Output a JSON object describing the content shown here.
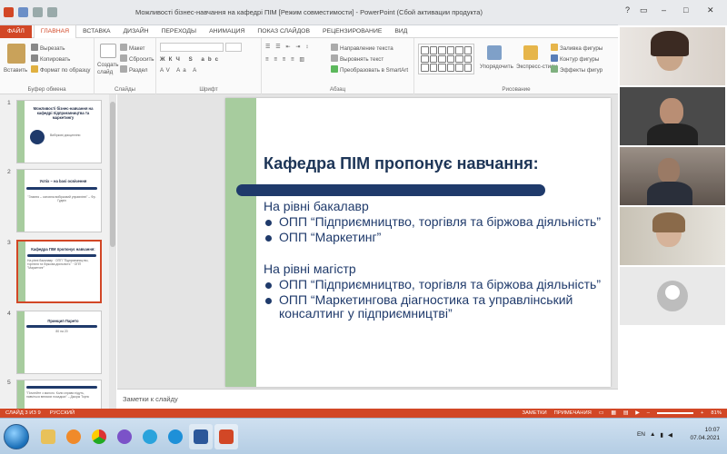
{
  "window": {
    "title": "Можливості бізнес-навчання на кафедрі ПІМ [Режим совместимости] - PowerPoint (Сбой активации продукта)",
    "controls": [
      "?",
      "–",
      "□",
      "✕"
    ]
  },
  "ribbon_tabs": [
    "ФАЙЛ",
    "ГЛАВНАЯ",
    "ВСТАВКА",
    "ДИЗАЙН",
    "ПЕРЕХОДЫ",
    "АНИМАЦИЯ",
    "ПОКАЗ СЛАЙДОВ",
    "РЕЦЕНЗИРОВАНИЕ",
    "ВИД"
  ],
  "ribbon": {
    "clipboard": {
      "paste": "Вставить",
      "cut": "Вырезать",
      "copy": "Копировать",
      "format": "Формат по образцу",
      "label": "Буфер обмена"
    },
    "slides": {
      "new_slide": "Создать слайд",
      "layout": "Макет",
      "reset": "Сбросить",
      "section": "Раздел",
      "label": "Слайды"
    },
    "font": {
      "label": "Шрифт"
    },
    "paragraph": {
      "text_dir": "Направление текста",
      "align": "Выровнять текст",
      "smartart": "Преобразовать в SmartArt",
      "label": "Абзац"
    },
    "drawing": {
      "arrange": "Упорядочить",
      "styles": "Экспресс-стили",
      "fill": "Заливка фигуры",
      "outline": "Контур фигуры",
      "effects": "Эффекты фигур",
      "label": "Рисование"
    }
  },
  "thumbnails": [
    {
      "num": "1",
      "title": "Можливості бізнес-навчання на кафедрі підприємництва та маркетингу",
      "sub": "Вибіркові дисципліни"
    },
    {
      "num": "2",
      "title": "Успіх – на basi освічення",
      "sub": "\"Знання – основна вибірковий управлінні\" – Фр. Гудвін"
    },
    {
      "num": "3",
      "title": "Кафедра ПІМ пропонує навчання:",
      "sub": "На рівні бакалавр · ОПП \"Підприємництво, торгівля та біржова діяльність\" · ОПП \"Маркетинг\""
    },
    {
      "num": "4",
      "title": "Принцип Парето",
      "sub": "80 на 20"
    },
    {
      "num": "5",
      "title": "",
      "sub": "\"Почнейте з малого. Коли справи підуть, навчіться великих посадках\" – Джорж Торнс"
    }
  ],
  "slide": {
    "heading": "Кафедра ПІМ пропонує навчання:",
    "level1": "На рівні бакалавр",
    "bullets1": [
      "ОПП “Підприємництво, торгівля та біржова діяльність”",
      "ОПП “Маркетинг”"
    ],
    "level2": "На рівні магістр",
    "bullets2": [
      "ОПП “Підприємництво, торгівля та біржова діяльність”",
      "ОПП “Маркетингова діагностика та управлінський консалтинг у підприємництві”"
    ]
  },
  "notes_placeholder": "Заметки к слайду",
  "status": {
    "slide_info": "СЛАЙД 3 ИЗ 9",
    "language": "РУССКИЙ",
    "notes": "ЗАМЕТКИ",
    "comments": "ПРИМЕЧАНИЯ",
    "zoom": "81%"
  },
  "tray": {
    "lang": "EN",
    "time": "10:07",
    "date": "07.04.2021"
  },
  "colors": {
    "accent": "#d24726",
    "slide_green": "#a7cc9e",
    "slide_navy": "#1f3a6b"
  }
}
